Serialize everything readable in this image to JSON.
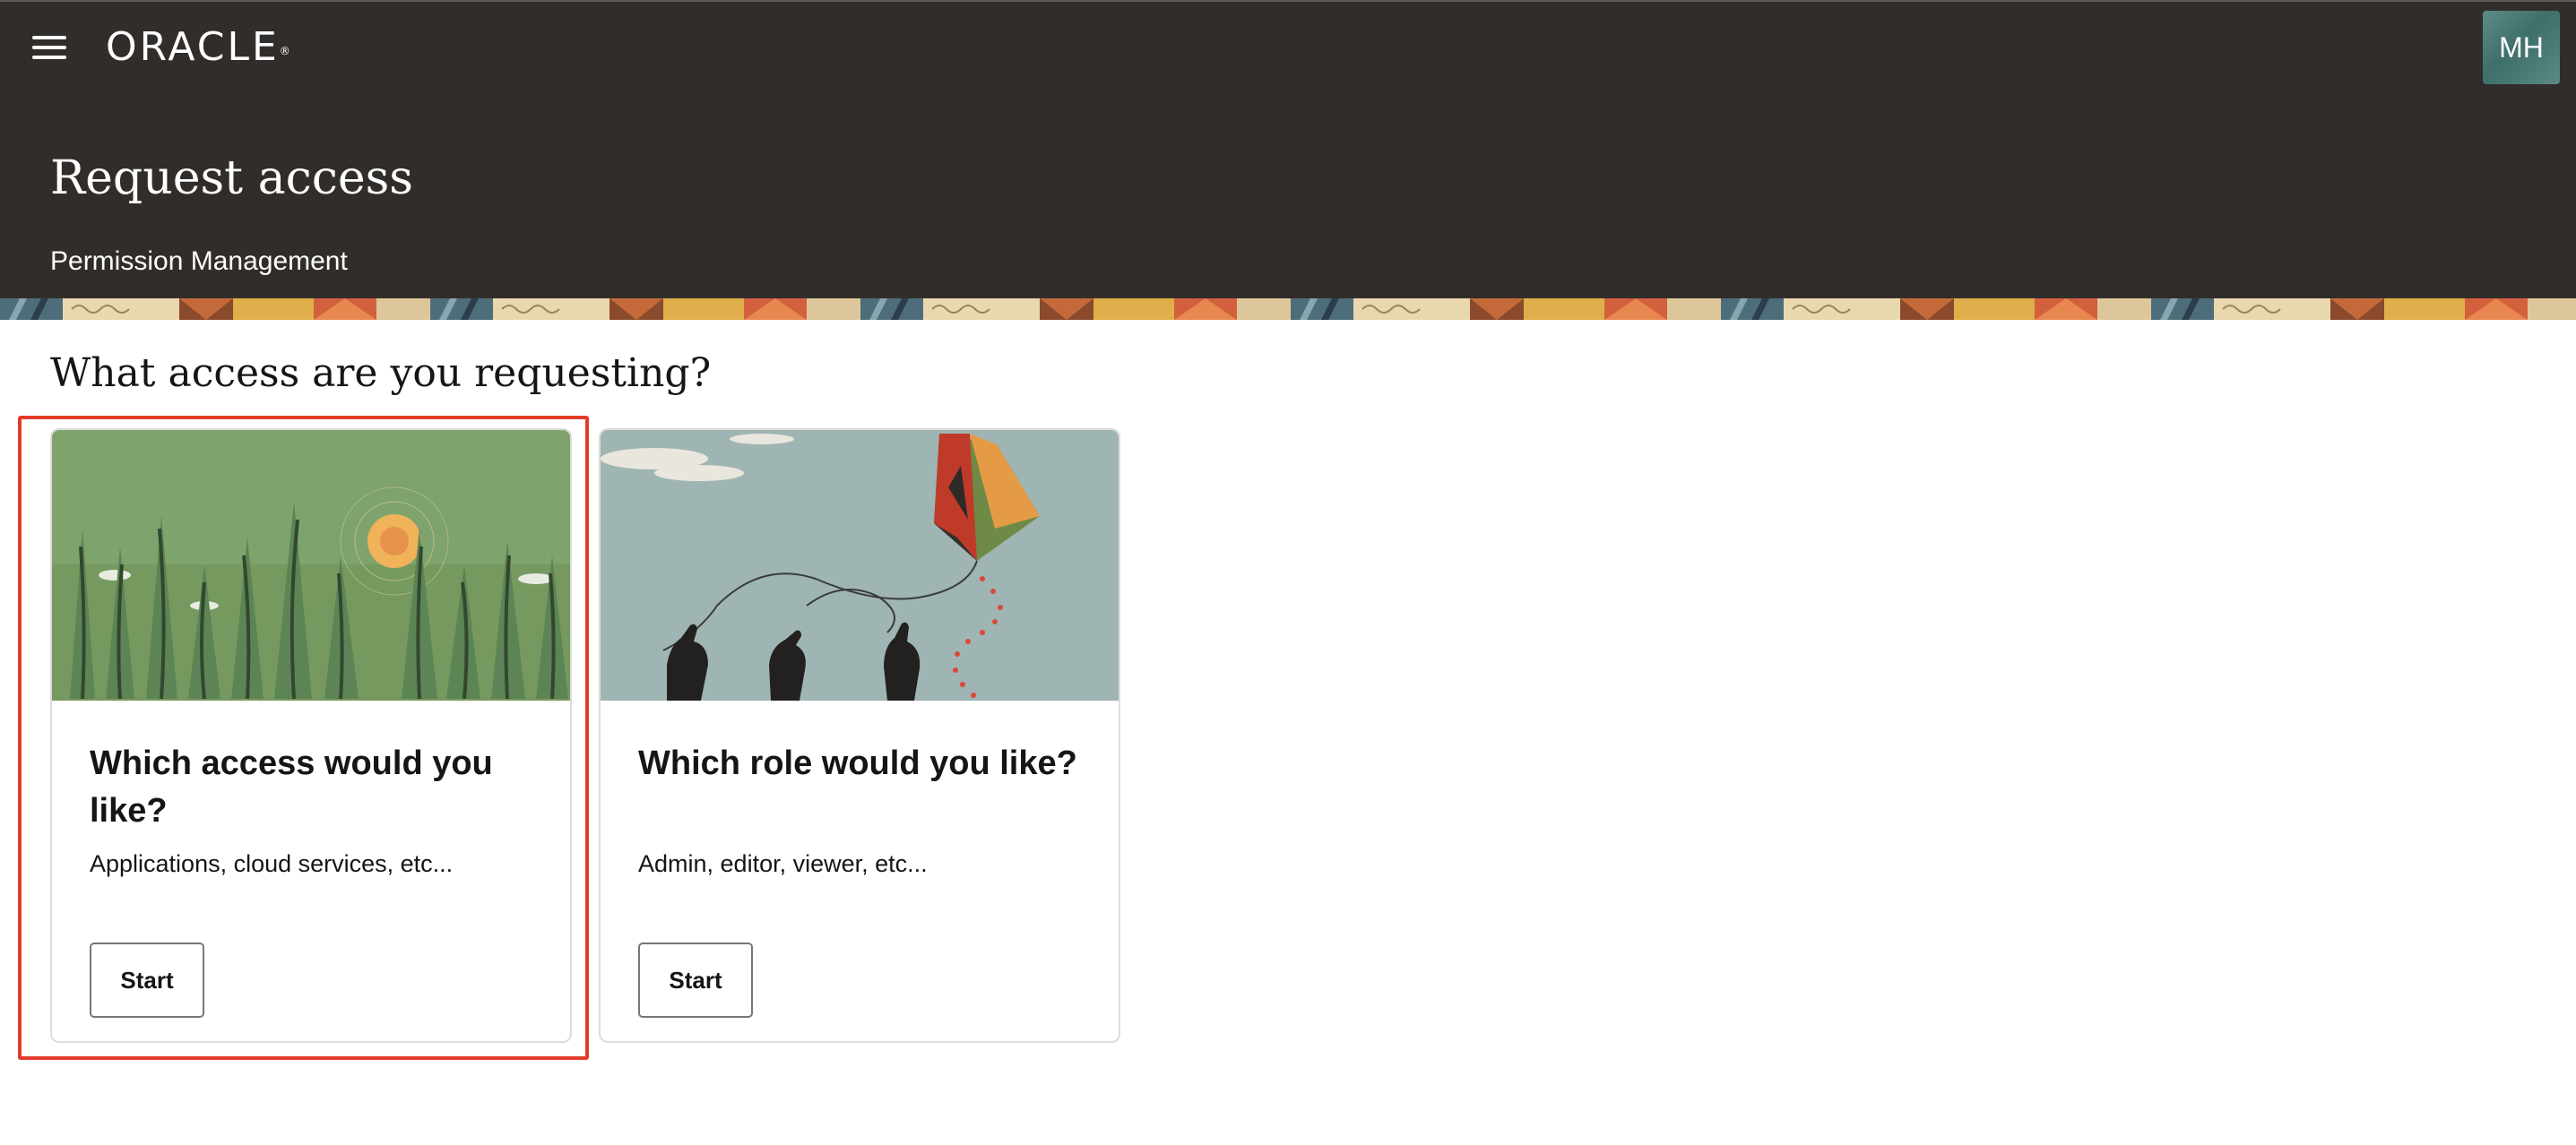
{
  "header": {
    "logo_text": "ORACLE",
    "logo_mark": "®",
    "menu_icon": "hamburger-menu-icon",
    "avatar_initials": "MH",
    "title": "Request access",
    "subtitle": "Permission Management"
  },
  "main": {
    "heading": "What access are you requesting?",
    "cards": [
      {
        "title": "Which access would you like?",
        "description": "Applications, cloud services, etc...",
        "button_label": "Start",
        "illustration": "forest-sun-illustration",
        "highlighted": true
      },
      {
        "title": "Which role would you like?",
        "description": "Admin, editor, viewer, etc...",
        "button_label": "Start",
        "illustration": "kite-hands-illustration",
        "highlighted": false
      }
    ]
  },
  "colors": {
    "header_bg": "#312d2a",
    "highlight": "#e33b2a",
    "forest_bg": "#7ea36c",
    "sky_bg": "#9fb5b4"
  }
}
